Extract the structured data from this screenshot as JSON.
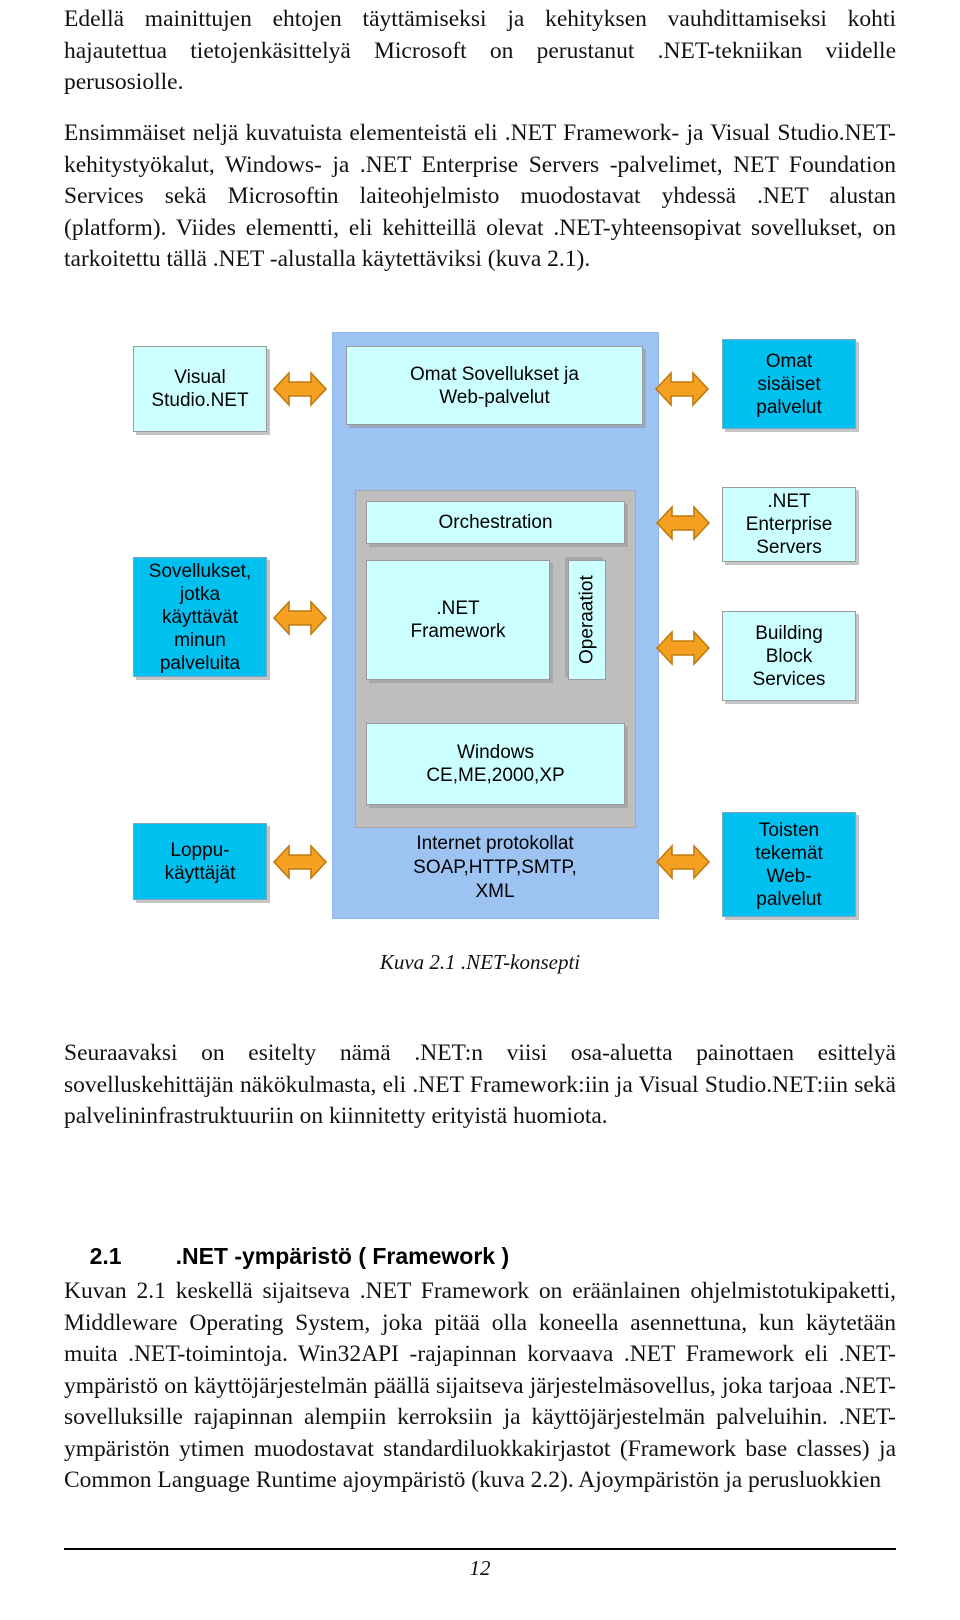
{
  "document": {
    "paragraphs": {
      "p1": "Edellä mainittujen ehtojen täyttämiseksi ja kehityksen vauhdittamiseksi kohti hajautettua tietojenkäsittelyä Microsoft on perustanut .NET-tekniikan viidelle perusosiolle.",
      "p2": "Ensimmäiset neljä kuvatuista elementeistä eli .NET Framework- ja Visual Studio.NET-kehitystyökalut, Windows- ja .NET Enterprise Servers -palvelimet, NET Foundation Services sekä Microsoftin laiteohjelmisto muodostavat yhdessä .NET alustan (platform). Viides elementti, eli kehitteillä olevat .NET-yhteensopivat sovellukset, on tarkoitettu tällä .NET -alustalla käytettäviksi (kuva 2.1).",
      "p3": "Seuraavaksi on esitelty nämä .NET:n viisi osa-aluetta painottaen esittelyä sovelluskehittäjän näkökulmasta, eli .NET Framework:iin ja Visual Studio.NET:iin sekä palvelininfrastruktuuriin on kiinnitetty erityistä huomiota.",
      "p4": "Kuvan 2.1 keskellä sijaitseva .NET Framework on eräänlainen ohjelmistotukipaketti, Middleware Operating System, joka pitää olla koneella asennettuna, kun käytetään muita .NET-toimintoja. Win32API -rajapinnan korvaava .NET Framework eli .NET-ympäristö on käyttöjärjestelmän päällä sijaitseva järjestelmäsovellus, joka tarjoaa .NET-sovelluksille rajapinnan alempiin kerroksiin ja käyttöjärjestelmän palveluihin. .NET-ympäristön ytimen muodostavat standardiluokkakirjastot (Framework base classes) ja Common Language Runtime ajoympäristö (kuva 2.2). Ajoympäristön ja perusluokkien"
    },
    "figure_caption": "Kuva 2.1 .NET-konsepti",
    "heading": {
      "number": "2.1",
      "title": ".NET -ympäristö ( Framework )"
    },
    "footer": {
      "page_number": "12"
    }
  },
  "figure": {
    "colors": {
      "box_light": "#CCFFFF",
      "box_cyan": "#00C0F0",
      "panel_blue": "#9DC3F2",
      "panel_grey": "#BEBEBE",
      "arrow": "#F5A020",
      "arrow_border": "#C07A10"
    },
    "boxes": {
      "visual_studio": "Visual\nStudio.NET",
      "omat_sovellukset": "Omat Sovellukset ja\nWeb-palvelut",
      "omat_sisaiset": "Omat\nsisäiset\npalvelut",
      "sovellukset_jotka": "Sovellukset,\njotka\nkäyttävät\nminun\npalveluita",
      "orchestration": "Orchestration",
      "net_framework": ".NET\nFramework",
      "operaatiot": "Operaatiot",
      "net_enterprise_servers": ".NET\nEnterprise\nServers",
      "building_block_services": "Building\nBlock\nServices",
      "windows": "Windows\nCE,ME,2000,XP",
      "internet_protokollat": "Internet protokollat\nSOAP,HTTP,SMTP,\nXML",
      "loppukayttajat": "Loppu-\nkäyttäjät",
      "toisten_tekemat": "Toisten\ntekemät\nWeb-\npalvelut"
    },
    "arrow_labels": {
      "a1": "double-headed-arrow-visual-studio",
      "a2": "double-headed-arrow-omat-sisaiset",
      "a3": "double-headed-arrow-enterprise-servers",
      "a4": "double-headed-arrow-sovellukset-jotka",
      "a5": "double-headed-arrow-building-block",
      "a6": "double-headed-arrow-loppukayttajat",
      "a7": "double-headed-arrow-toisten-tekemat"
    }
  }
}
